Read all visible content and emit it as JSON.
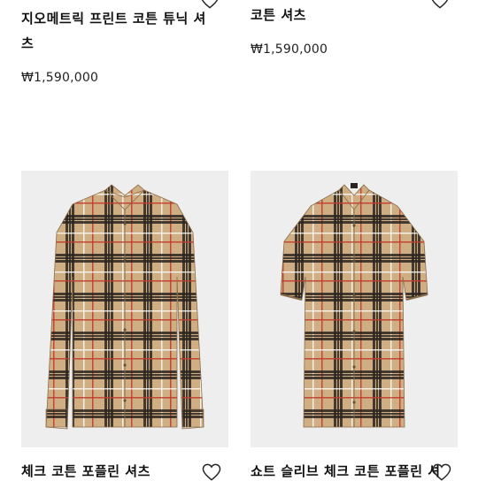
{
  "products": [
    {
      "title_line1": "지오메트릭 프린트 코튼 튜닉 셔",
      "title_line2": "츠",
      "price": "₩1,590,000",
      "wishlist_icon": "heart-outline-icon"
    },
    {
      "title_line1": "코튼 셔츠",
      "price": "₩1,590,000",
      "wishlist_icon": "heart-outline-icon"
    },
    {
      "title_line1": "체크 코튼 포플린 셔츠",
      "image_alt": "check shirt long sleeve",
      "wishlist_icon": "heart-outline-icon"
    },
    {
      "title_line1": "쇼트 슬리브 체크 코튼 포플린 셔",
      "image_alt": "check shirt short sleeve",
      "wishlist_icon": "heart-outline-icon"
    }
  ],
  "colors": {
    "check_base": "#c9a77c",
    "check_dark": "#2a2420",
    "check_red": "#c43b2c",
    "image_bg": "#eeeeee"
  }
}
